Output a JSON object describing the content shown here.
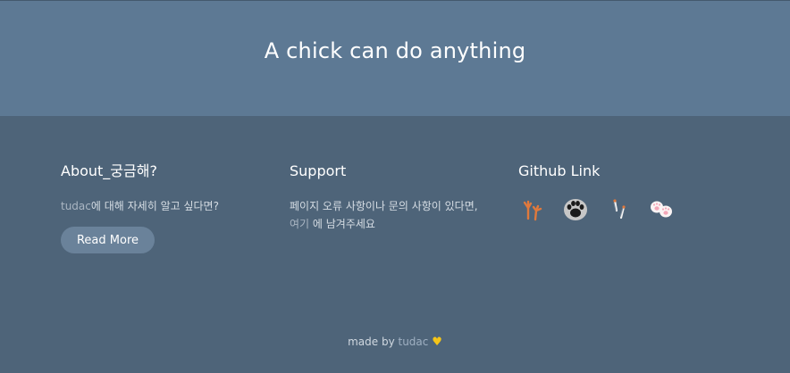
{
  "hero": {
    "title": "A chick can do anything"
  },
  "about": {
    "title": "About_궁금해?",
    "text_brand": "tudac",
    "text_rest": "에 대해 자세히 알고 싶다면?",
    "button_label": "Read More"
  },
  "support": {
    "title": "Support",
    "line1": "페이지 오류 사항이나 문의 사항이 있다면,",
    "link_label": "여기",
    "line2_rest": " 에 남겨주세요"
  },
  "github": {
    "title": "Github Link",
    "icons": [
      "chick-feet-icon",
      "paw-icon",
      "feather-icon",
      "pink-paw-icon"
    ]
  },
  "footer": {
    "prefix": "made by ",
    "brand": "tudac",
    "heart": "♥"
  }
}
